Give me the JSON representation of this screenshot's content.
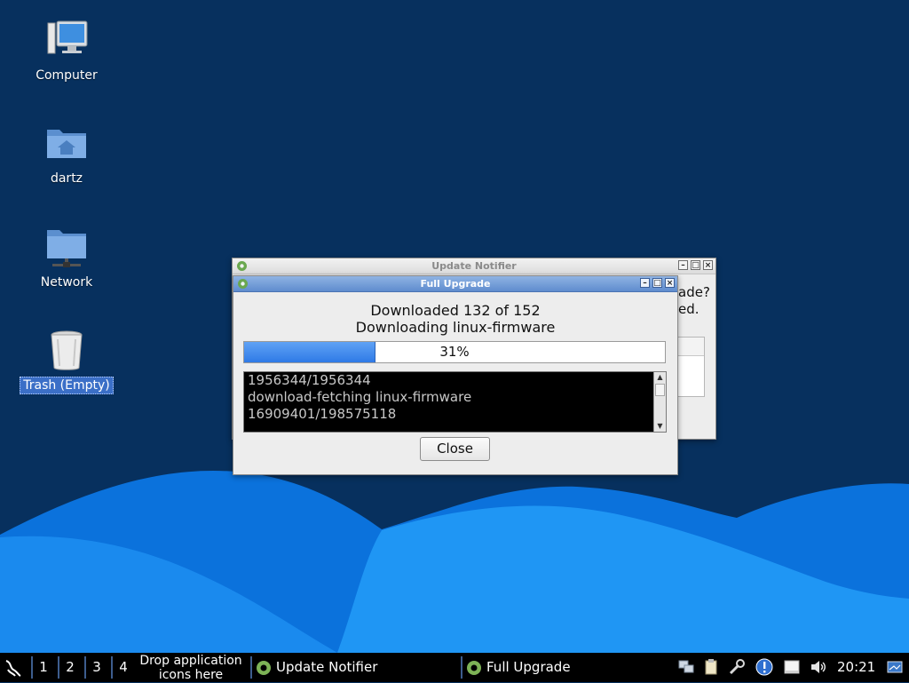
{
  "desktop": {
    "icons": [
      {
        "label": "Computer"
      },
      {
        "label": "dartz"
      },
      {
        "label": "Network"
      },
      {
        "label": "Trash (Empty)"
      }
    ]
  },
  "update_notifier": {
    "title": "Update Notifier",
    "partial_text_line1": "ade?",
    "partial_text_line2": "ed."
  },
  "full_upgrade": {
    "title": "Full Upgrade",
    "status_line1": "Downloaded 132 of 152",
    "status_line2": "Downloading linux-firmware",
    "progress_percent": 31,
    "progress_label": "31%",
    "terminal_lines": [
      "1956344/1956344",
      "download-fetching linux-firmware",
      "16909401/198575118"
    ],
    "close_label": "Close"
  },
  "taskbar": {
    "workspaces": [
      "1",
      "2",
      "3",
      "4"
    ],
    "launcher_line1": "Drop application",
    "launcher_line2": "icons here",
    "tasks": [
      {
        "label": "Update Notifier"
      },
      {
        "label": "Full Upgrade"
      }
    ],
    "clock": "20:21"
  },
  "colors": {
    "desktop_bg": "#07305e",
    "wave_dark": "#0b6fd9",
    "wave_light": "#1d93f2",
    "accent": "#5f8cce"
  }
}
